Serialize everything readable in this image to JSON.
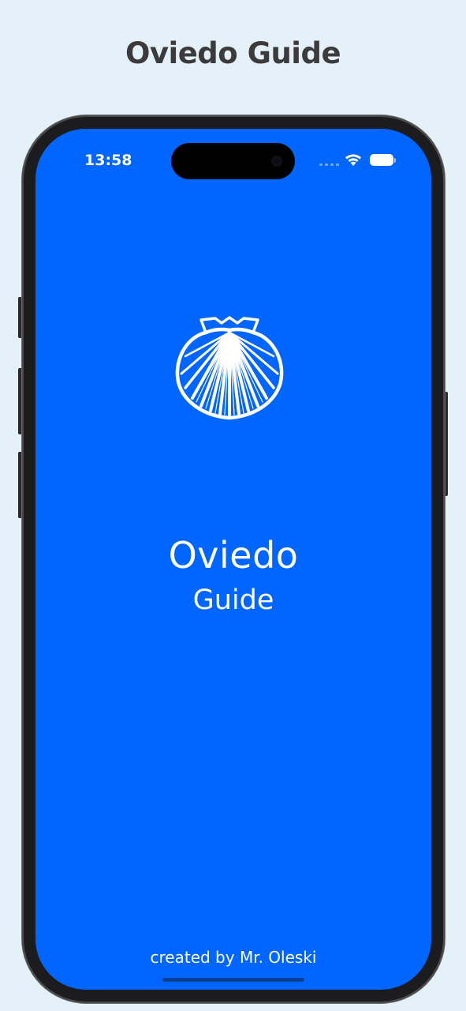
{
  "header": {
    "title": "Oviedo Guide"
  },
  "status_bar": {
    "time": "13:58",
    "icons": [
      "cellular-signal-icon",
      "wifi-icon",
      "battery-icon"
    ]
  },
  "splash": {
    "logo_icon": "scallop-shell-icon",
    "title": "Oviedo",
    "subtitle": "Guide",
    "credit": "created by Mr. Oleski"
  },
  "colors": {
    "background": "#e5f1f8",
    "screen": "#0066ff",
    "text": "#ffffff",
    "headline": "#3b3b3b"
  }
}
